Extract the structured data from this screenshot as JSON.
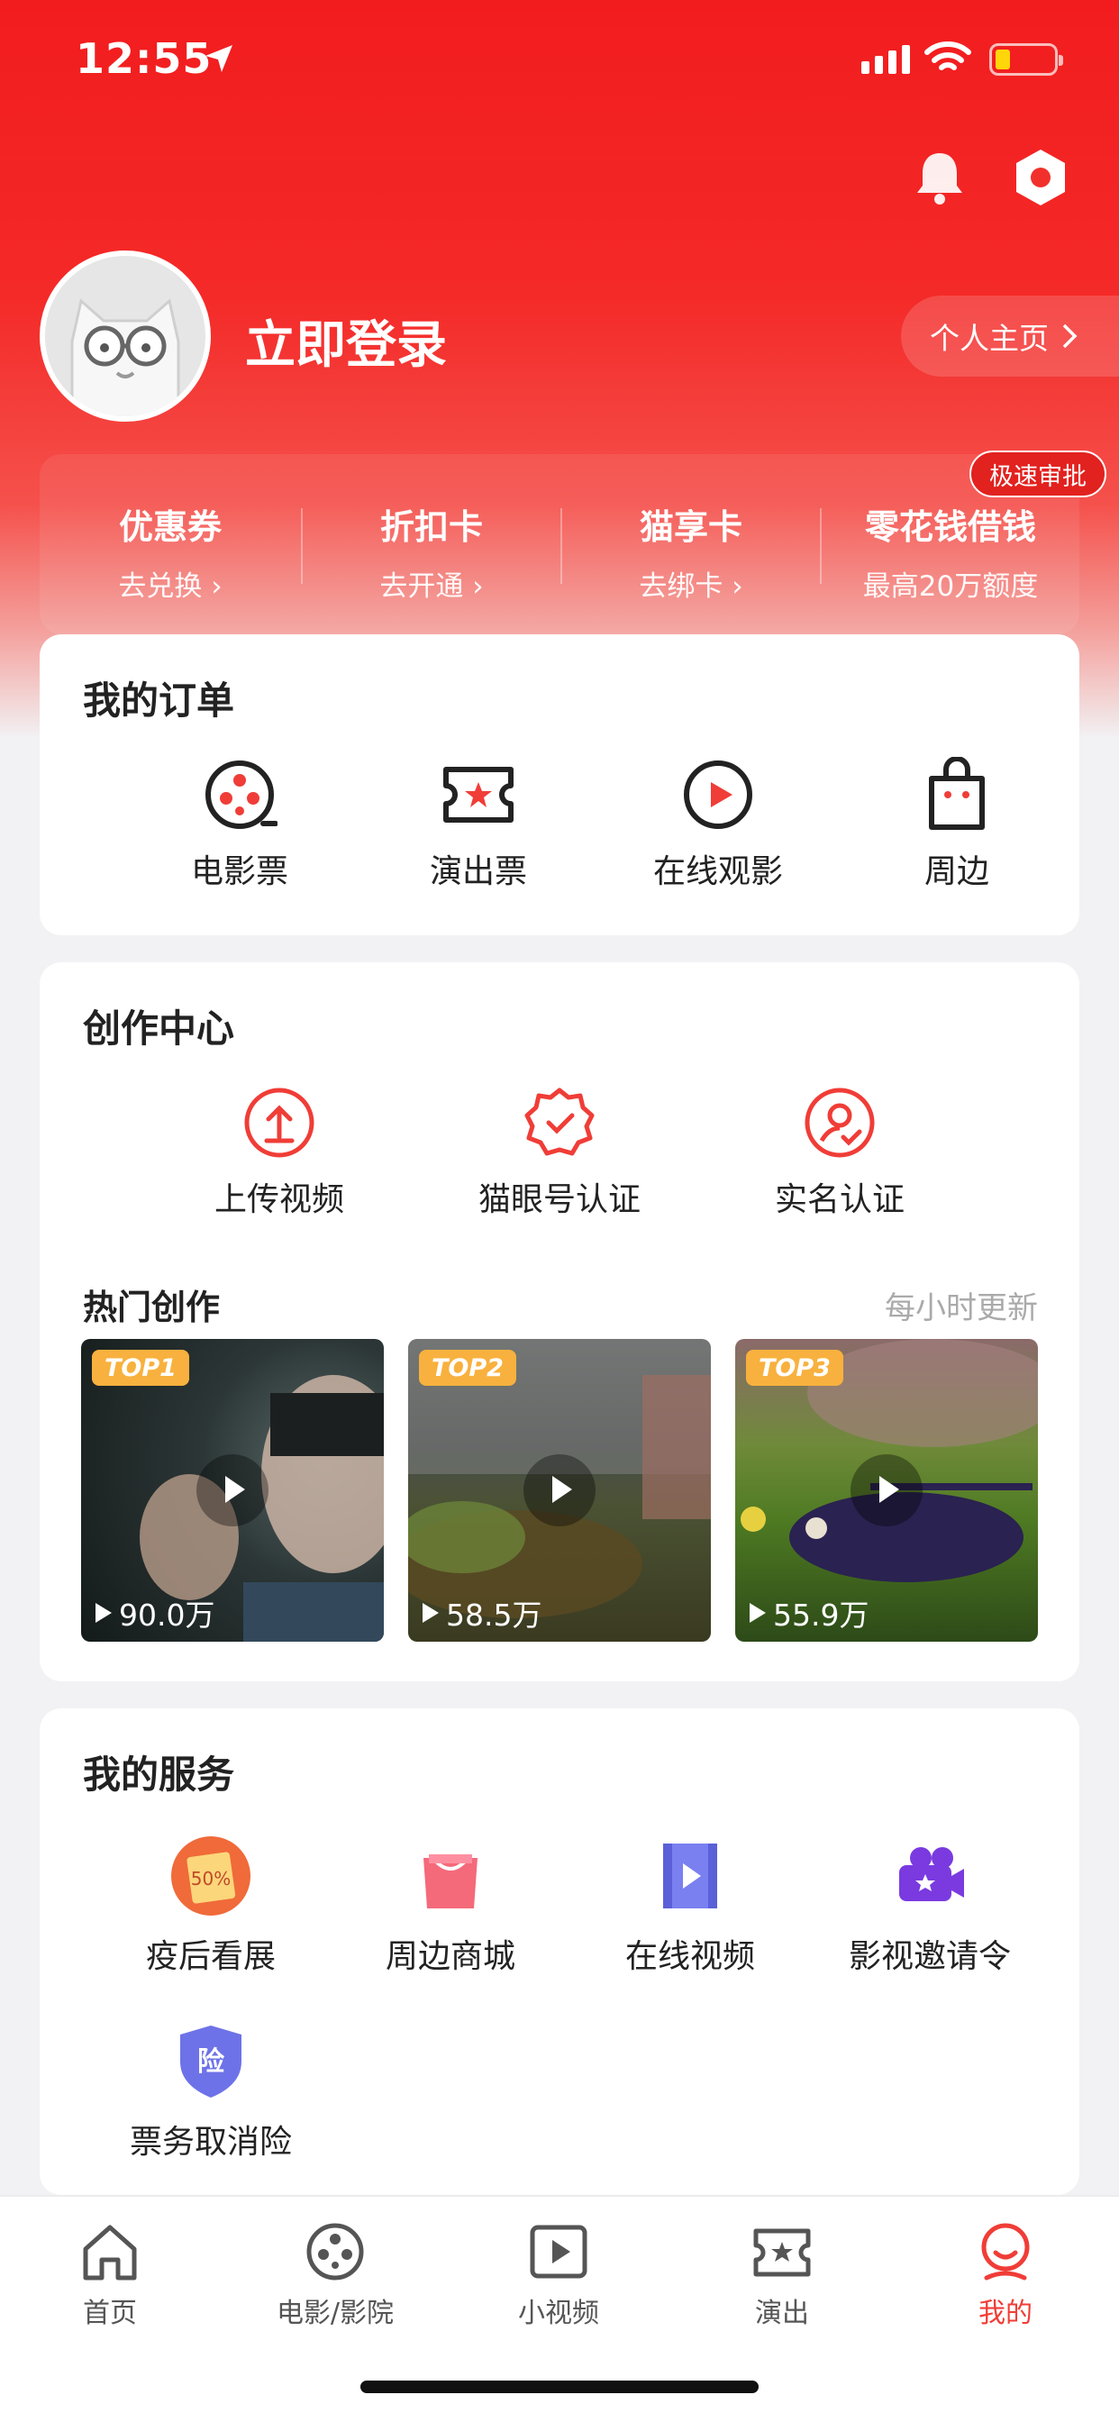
{
  "status": {
    "time": "12:55"
  },
  "header": {
    "login": "立即登录",
    "profile_link": "个人主页"
  },
  "quick_links": [
    {
      "title": "优惠券",
      "sub": "去兑换"
    },
    {
      "title": "折扣卡",
      "sub": "去开通"
    },
    {
      "title": "猫享卡",
      "sub": "去绑卡"
    },
    {
      "title": "零花钱借钱",
      "sub": "最高20万额度"
    }
  ],
  "fast_badge": "极速审批",
  "orders": {
    "title": "我的订单",
    "items": [
      "电影票",
      "演出票",
      "在线观影",
      "周边"
    ]
  },
  "creation": {
    "title": "创作中心",
    "items": [
      "上传视频",
      "猫眼号认证",
      "实名认证"
    ],
    "hot_title": "热门创作",
    "hot_update": "每小时更新",
    "videos": [
      {
        "rank": "TOP1",
        "views": "90.0万"
      },
      {
        "rank": "TOP2",
        "views": "58.5万"
      },
      {
        "rank": "TOP3",
        "views": "55.9万"
      }
    ]
  },
  "services": {
    "title": "我的服务",
    "items": [
      "疫后看展",
      "周边商城",
      "在线视频",
      "影视邀请令",
      "票务取消险"
    ],
    "badge_50": "50%",
    "insurance_char": "险"
  },
  "tabs": [
    "首页",
    "电影/影院",
    "小视频",
    "演出",
    "我的"
  ],
  "colors": {
    "brand_red": "#f21c1e",
    "active_tab": "#f03d37"
  }
}
